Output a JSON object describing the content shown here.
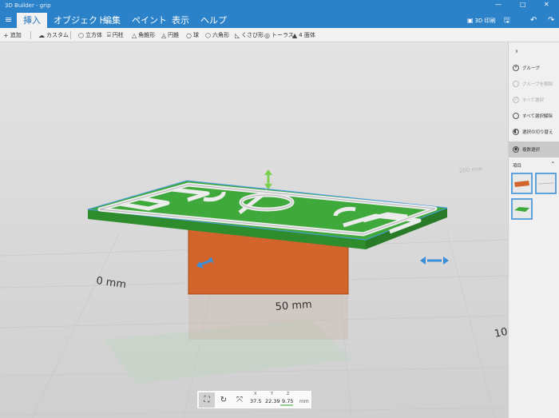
{
  "window": {
    "title": "3D Builder - grip",
    "controls": {
      "minimize": "—",
      "maximize": "□",
      "close": "✕"
    }
  },
  "menu": {
    "tabs": [
      {
        "label": "挿入",
        "active": true
      },
      {
        "label": "オブジェクト",
        "active": false
      },
      {
        "label": "編集",
        "active": false
      },
      {
        "label": "ペイント",
        "active": false
      },
      {
        "label": "表示",
        "active": false
      },
      {
        "label": "ヘルプ",
        "active": false
      }
    ],
    "print_3d": "3D 印刷",
    "save_icon": "save-icon",
    "undo_icon": "undo-icon",
    "redo_icon": "redo-icon"
  },
  "ribbon": {
    "add": "追加",
    "custom": "カスタム",
    "cube": "立方体",
    "cylinder": "円柱",
    "pyramid": "角錐形",
    "cone": "円錐",
    "sphere": "球",
    "hexagon": "六角形",
    "wedge": "くさび形",
    "torus": "トーラス",
    "tetrahedron": "4 面体"
  },
  "panel": {
    "group": "グループ",
    "ungroup": "グループを解除",
    "select_all": "すべて選択",
    "deselect_all": "すべて選択解除",
    "invert_selection": "選択の切り替え",
    "multi_select": "複数選択",
    "items_header": "項目"
  },
  "viewport": {
    "ruler_zero": "0 mm",
    "ruler_fifty": "50 mm",
    "ruler_hundred": "10",
    "ruler_far": "200 mm",
    "colors": {
      "plate": "#3fa93c",
      "walls": "#ececec",
      "block": "#d2642c",
      "selection": "#4a9be0"
    }
  },
  "coords": {
    "x_label": "X",
    "x": "37.5",
    "y_label": "Y",
    "y": "22.39",
    "z_label": "Z",
    "z": "9.75",
    "unit": "mm"
  }
}
